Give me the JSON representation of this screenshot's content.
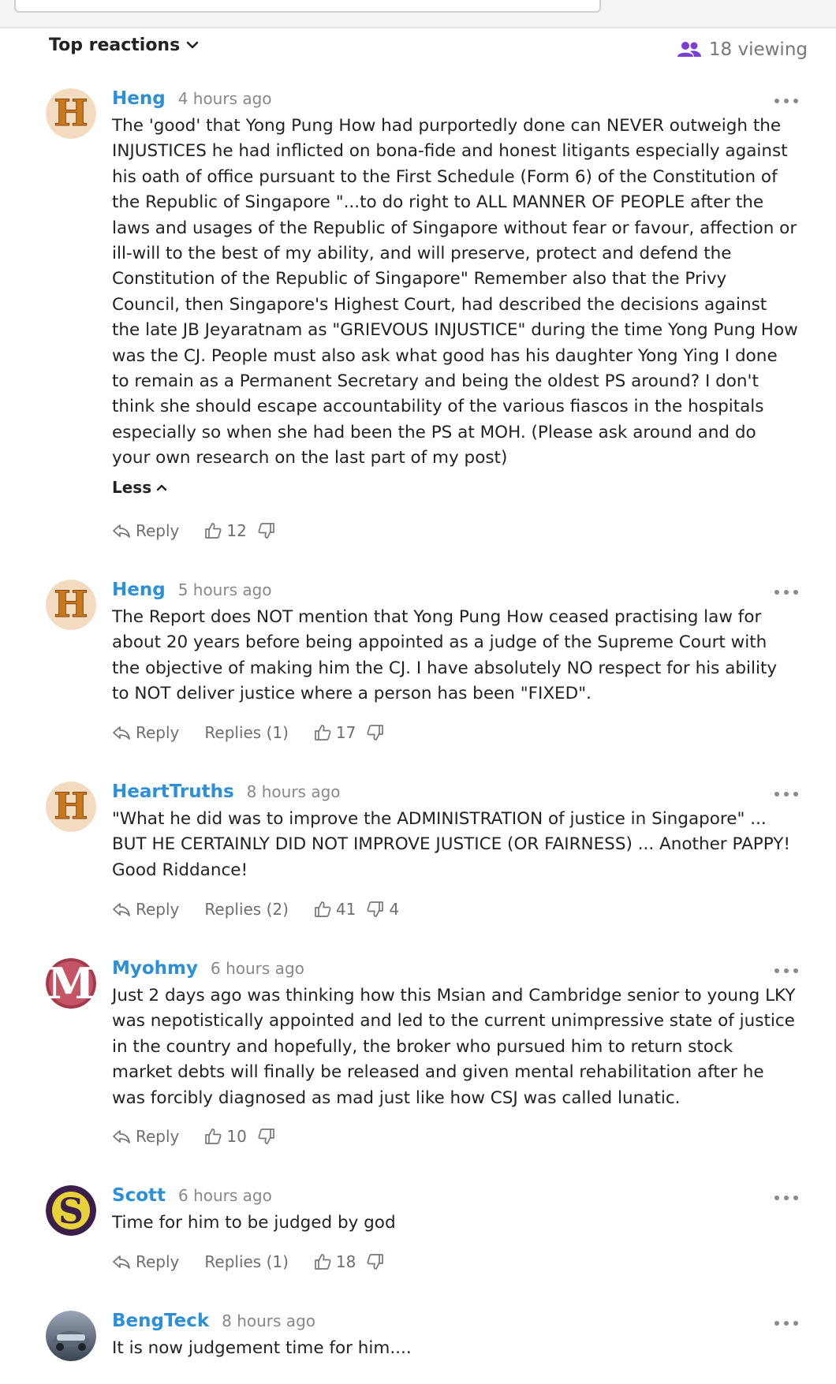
{
  "header": {
    "sort_label": "Top reactions",
    "viewing_label": "18 viewing"
  },
  "labels": {
    "reply": "Reply",
    "less": "Less"
  },
  "comments": [
    {
      "user": "Heng",
      "time": "4 hours ago",
      "avatar_letter": "H",
      "body": "The 'good' that Yong Pung How had purportedly done can NEVER outweigh the INJUSTICES he had inflicted on bona-fide and honest litigants especially against his oath of office pursuant to the First Schedule (Form 6) of the Constitution of the Republic of Singapore \"...to do right to ALL MANNER OF PEOPLE after the laws and usages of the Republic of Singapore without fear or favour, affection or ill-will to the best of my ability, and will preserve, protect and defend the Constitution of the Republic of Singapore\" Remember also that the Privy Council, then Singapore's Highest Court, had described the decisions against the late JB Jeyaratnam as \"GRIEVOUS INJUSTICE\" during the time Yong Pung How was the CJ. People must also ask what good has his daughter Yong Ying I done to remain as a Permanent Secretary and being the oldest PS around? I don't think she should escape accountability of the various fiascos in the hospitals especially so when she had been the PS at MOH. (Please ask around and do your own research on the last part of my post)",
      "likes": "12",
      "dislikes": "",
      "replies": ""
    },
    {
      "user": "Heng",
      "time": "5 hours ago",
      "avatar_letter": "H",
      "body": "The Report does NOT mention that Yong Pung How ceased practising law for about 20 years before being appointed as a judge of the Supreme Court with the objective of making him the CJ. I have absolutely NO respect for his ability to NOT deliver justice where a person has been \"FIXED\".",
      "likes": "17",
      "dislikes": "",
      "replies": "Replies (1)"
    },
    {
      "user": "HeartTruths",
      "time": "8 hours ago",
      "avatar_letter": "H",
      "body": "\"What he did was to improve the ADMINISTRATION of justice in Singapore\" ... BUT HE CERTAINLY DID NOT IMPROVE JUSTICE (OR FAIRNESS) ... Another PAPPY! Good Riddance!",
      "likes": "41",
      "dislikes": "4",
      "replies": "Replies (2)"
    },
    {
      "user": "Myohmy",
      "time": "6 hours ago",
      "avatar_letter": "M",
      "body": "Just 2 days ago was thinking how this Msian and Cambridge senior to young LKY was nepotistically appointed and led to the current unimpressive state of justice in the country and hopefully, the broker who pursued him to return stock market debts will finally be released and given mental rehabilitation after he was forcibly diagnosed as mad just like how CSJ was called lunatic.",
      "likes": "10",
      "dislikes": "",
      "replies": ""
    },
    {
      "user": "Scott",
      "time": "6 hours ago",
      "avatar_letter": "S",
      "body": "Time for him to be judged by god",
      "likes": "18",
      "dislikes": "",
      "replies": "Replies (1)"
    },
    {
      "user": "BengTeck",
      "time": "8 hours ago",
      "avatar_letter": "",
      "body": "It is now judgement time for him....",
      "likes": "",
      "dislikes": "",
      "replies": ""
    }
  ]
}
